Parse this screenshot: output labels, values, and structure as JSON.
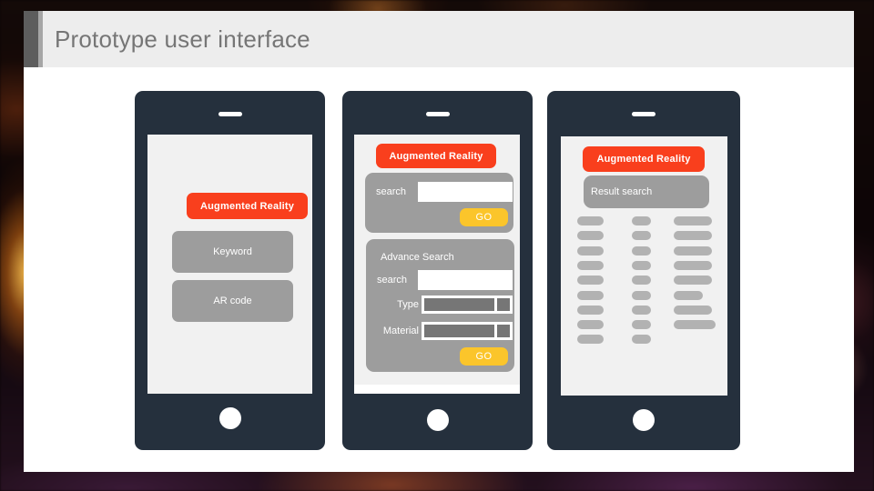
{
  "slide": {
    "title": "Prototype user interface",
    "background_color": "#0a0406",
    "panel_color": "#ffffff",
    "title_bar_color": "#ededed",
    "accent_color": "#5d5d5d"
  },
  "palette": {
    "phone_body": "#25303d",
    "screen": "#f1f1f1",
    "red_button": "#f93f1d",
    "gray_button": "#9d9d9d",
    "go_button": "#fbc52b",
    "select_fill": "#767676",
    "result_bar": "#b2b2b2",
    "title_text": "#767676"
  },
  "mockups": [
    {
      "name": "home-screen",
      "buttons": [
        {
          "label": "Augmented Reality",
          "style": "red"
        },
        {
          "label": "Keyword",
          "style": "gray"
        },
        {
          "label": "AR code",
          "style": "gray"
        }
      ]
    },
    {
      "name": "search-screen",
      "header_label": "Augmented Reality",
      "quick_search": {
        "search_label": "search",
        "search_value": "",
        "go_label": "GO"
      },
      "advance_search": {
        "section_title": "Advance Search",
        "search_label": "search",
        "search_value": "",
        "type_label": "Type",
        "type_value": "",
        "material_label": "Material",
        "material_value": "",
        "go_label": "GO"
      }
    },
    {
      "name": "results-screen",
      "header_label": "Augmented Reality",
      "results_title": "Result search",
      "result_rows": [
        [
          56,
          40,
          80
        ],
        [
          56,
          40,
          80
        ],
        [
          56,
          40,
          80
        ],
        [
          56,
          40,
          80
        ],
        [
          56,
          40,
          80
        ],
        [
          56,
          40,
          62
        ],
        [
          56,
          40,
          80
        ],
        [
          56,
          40,
          88
        ],
        [
          56,
          40,
          0
        ]
      ]
    }
  ]
}
